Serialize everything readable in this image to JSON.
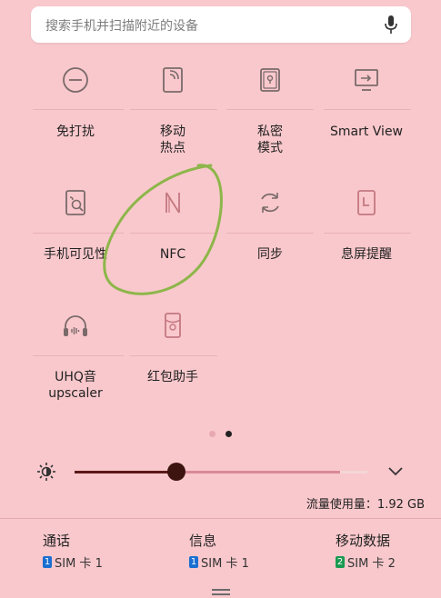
{
  "search": {
    "placeholder": "搜索手机并扫描附近的设备"
  },
  "tiles": [
    {
      "label": "免打扰"
    },
    {
      "label": "移动",
      "label2": "热点"
    },
    {
      "label": "私密",
      "label2": "模式"
    },
    {
      "label": "Smart View"
    },
    {
      "label": "手机可见性"
    },
    {
      "label": "NFC"
    },
    {
      "label": "同步"
    },
    {
      "label": "息屏提醒"
    },
    {
      "label": "UHQ音",
      "label2": "upscaler"
    },
    {
      "label": "红包助手"
    }
  ],
  "brightness": {
    "level": 0.4
  },
  "usage": "流量使用量：1.92 GB",
  "bottom": [
    {
      "title": "通话",
      "sim_num": "1",
      "sim_label": "SIM 卡 1"
    },
    {
      "title": "信息",
      "sim_num": "1",
      "sim_label": "SIM 卡 1"
    },
    {
      "title": "移动数据",
      "sim_num": "2",
      "sim_label": "SIM 卡 2"
    }
  ],
  "colors": {
    "background": "#f9c8cc",
    "icon": "#7a5a5a",
    "sim1": "#1a6fd0",
    "sim2": "#1a9a50",
    "annotation": "#8db64a"
  }
}
